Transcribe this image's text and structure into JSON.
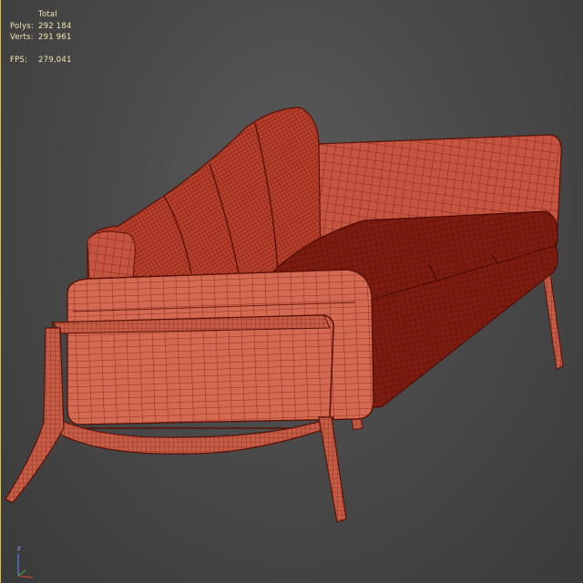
{
  "stats": {
    "header": "Total",
    "polys_label": "Polys:",
    "polys_value": "292 184",
    "verts_label": "Verts:",
    "verts_value": "291 961",
    "fps_label": "FPS:",
    "fps_value": "279,041"
  },
  "gizmo": {
    "z_label": "z"
  },
  "colors": {
    "wire": "#b83a2a",
    "surface": "#d0604a",
    "surface_dark": "#8a2418",
    "viewport_bg": "#4a4a4a",
    "active_border": "#e0c040",
    "stats_text": "#f2e6b0"
  },
  "scene": {
    "object": "sofa-wireframe-model"
  }
}
